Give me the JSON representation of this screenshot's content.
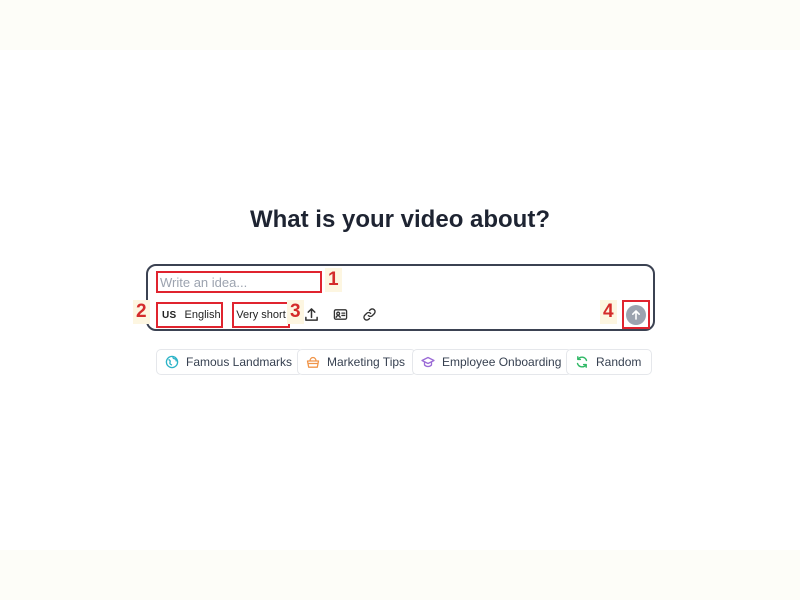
{
  "heading": "What is your video about?",
  "prompt": {
    "placeholder": "Write an idea...",
    "value": "",
    "language": {
      "flag": "US",
      "label": "English"
    },
    "length": "Very short",
    "tools": [
      {
        "icon": "upload-icon"
      },
      {
        "icon": "avatar-card-icon"
      },
      {
        "icon": "link-icon"
      }
    ],
    "submit_icon": "arrow-up-icon"
  },
  "markers": [
    "1",
    "2",
    "3",
    "4"
  ],
  "suggestions": [
    {
      "label": "Famous Landmarks",
      "icon": "globe-icon",
      "color": "#2bb3c7"
    },
    {
      "label": "Marketing Tips",
      "icon": "basket-icon",
      "color": "#f0954a"
    },
    {
      "label": "Employee Onboarding",
      "icon": "graduation-cap-icon",
      "color": "#9b6bd6"
    },
    {
      "label": "Random",
      "icon": "refresh-icon",
      "color": "#2fb865"
    }
  ],
  "colors": {
    "annotation": "#e0242f",
    "submit_disabled": "#9ca3af",
    "heading": "#1e2432"
  }
}
